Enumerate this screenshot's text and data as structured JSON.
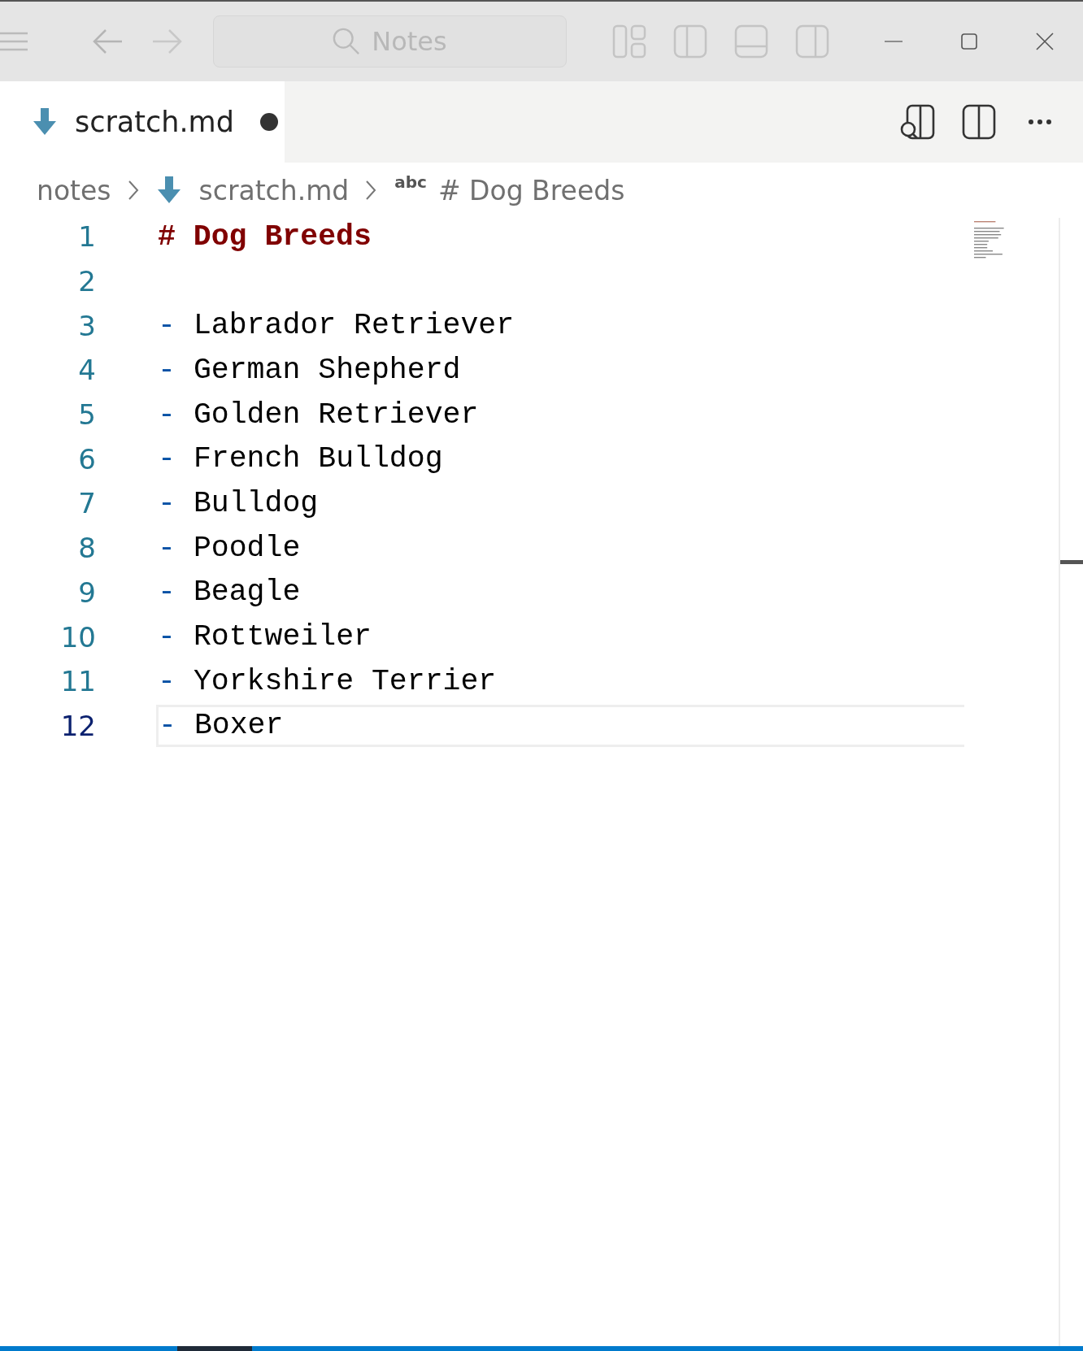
{
  "title_bar": {
    "search": {
      "label": "Notes"
    }
  },
  "tabs": [
    {
      "label": "scratch.md",
      "selected": true,
      "modified": true
    }
  ],
  "breadcrumbs": [
    {
      "kind": "folder",
      "label": "notes"
    },
    {
      "kind": "file",
      "label": "scratch.md"
    },
    {
      "kind": "symbol",
      "icon_text": "abc",
      "label": "# Dog Breeds"
    }
  ],
  "editor": {
    "lines": [
      {
        "number": "1",
        "kind": "heading",
        "text": "# Dog Breeds",
        "selected": false
      },
      {
        "number": "2",
        "kind": "blank",
        "selected": false
      },
      {
        "number": "3",
        "kind": "list",
        "marker": "-",
        "text": "Labrador Retriever",
        "selected": false
      },
      {
        "number": "4",
        "kind": "list",
        "marker": "-",
        "text": "German Shepherd",
        "selected": false
      },
      {
        "number": "5",
        "kind": "list",
        "marker": "-",
        "text": "Golden Retriever",
        "selected": false
      },
      {
        "number": "6",
        "kind": "list",
        "marker": "-",
        "text": "French Bulldog",
        "selected": false
      },
      {
        "number": "7",
        "kind": "list",
        "marker": "-",
        "text": "Bulldog",
        "selected": false
      },
      {
        "number": "8",
        "kind": "list",
        "marker": "-",
        "text": "Poodle",
        "selected": false
      },
      {
        "number": "9",
        "kind": "list",
        "marker": "-",
        "text": "Beagle",
        "selected": false
      },
      {
        "number": "10",
        "kind": "list",
        "marker": "-",
        "text": "Rottweiler",
        "selected": false
      },
      {
        "number": "11",
        "kind": "list",
        "marker": "-",
        "text": "Yorkshire Terrier",
        "selected": false
      },
      {
        "number": "12",
        "kind": "list",
        "marker": "-",
        "text": "Boxer",
        "selected": true
      }
    ]
  }
}
